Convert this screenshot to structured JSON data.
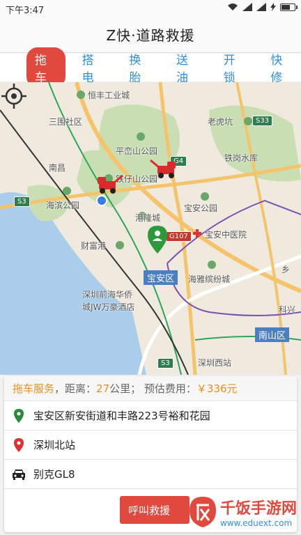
{
  "status_bar": {
    "time": "下午3:47"
  },
  "title": "Z快·道路救援",
  "tabs": [
    {
      "label": "拖车",
      "active": true
    },
    {
      "label": "搭电",
      "active": false
    },
    {
      "label": "换胎",
      "active": false
    },
    {
      "label": "送油",
      "active": false
    },
    {
      "label": "开锁",
      "active": false
    },
    {
      "label": "快修",
      "active": false
    }
  ],
  "map": {
    "labels": {
      "hengfeng": "恒丰工业城",
      "sanwei": "三围社区",
      "laohukeng": "老虎坑",
      "pingluanshan": "平峦山公园",
      "tiegang": "铁岗水库",
      "nanchang": "南昌",
      "tiezaishan": "铁仔山公园",
      "haibin": "海滨公园",
      "baoan_park": "宝安公园",
      "ganglongcheng": "港隆城",
      "baoan_hospital": "宝安中医院",
      "caifugang": "财富港",
      "haiya": "海雅缤纷城",
      "qianhai": "深圳前海华侨",
      "jw": "城JW万豪酒店",
      "keji": "科兴",
      "shenzhenxi": "深圳西站",
      "xiang": "乡"
    },
    "districts": {
      "baoan": "宝安区",
      "nanshan": "南山区"
    },
    "roads": {
      "s33": "S33",
      "g4": "G4",
      "s3a": "S3",
      "g107": "G107",
      "s3b": "S3"
    }
  },
  "summary": {
    "service": "拖车服务",
    "distance_label": "，距离：",
    "distance_value": "27",
    "distance_unit": "公里",
    "fee_label": "；  预估费用：",
    "fee_value": "￥336元"
  },
  "start_address": "宝安区新安街道和丰路223号裕和花园",
  "destination": "深圳北站",
  "car_model": "别克GL8",
  "call_button": "呼叫救援",
  "watermark": {
    "title": "千饭手游网",
    "url": "www.eduext.com"
  },
  "colors": {
    "accent_red": "#e2493e",
    "tab_blue": "#2f8fd8",
    "fee_orange": "#f08c1e"
  }
}
